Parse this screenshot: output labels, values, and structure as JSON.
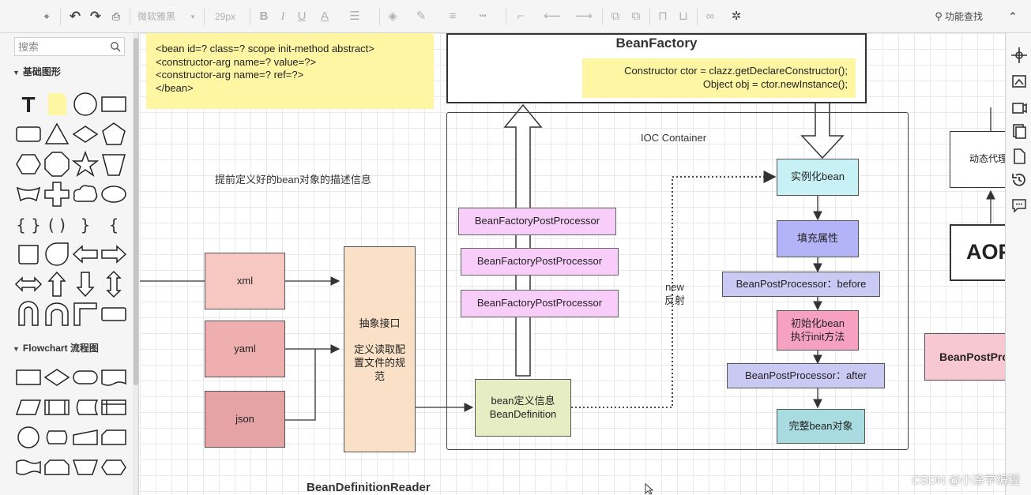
{
  "toolbar": {
    "font_family": "微软雅黑",
    "font_size": "29px",
    "search_label": "功能查找"
  },
  "sidebar": {
    "search_placeholder": "搜索",
    "section_basic": "基础图形",
    "section_flowchart": "Flowchart 流程图"
  },
  "diagram": {
    "note_bean_lines": [
      "<bean id=? class=? scope init-method  abstract>",
      "<constructor-arg name=? value=?>",
      "<constructor-arg  name=? ref=?>",
      "</bean>"
    ],
    "bean_factory_title": "BeanFactory",
    "ctor_note_lines": [
      "Constructor ctor = clazz.getDeclareConstructor();",
      "Object obj = ctor.newInstance();"
    ],
    "ioc_title": "IOC  Container",
    "desc_text": "提前定义好的bean对象的描述信息",
    "sources": [
      "xml",
      "yaml",
      "json"
    ],
    "reader_lines": [
      "抽象接口",
      "定义读取配置文件的规范"
    ],
    "reader_caption": "BeanDefinitionReader",
    "post_processors": [
      "BeanFactoryPostProcessor",
      "BeanFactoryPostProcessor",
      "BeanFactoryPostProcessor"
    ],
    "bean_def_lines": [
      "bean定义信息",
      "BeanDefinition"
    ],
    "new_label": "new",
    "reflect_label": "反射",
    "instantiate": "实例化bean",
    "populate": "填充属性",
    "bpp_before": "BeanPostProcessor：before",
    "init_lines": [
      "初始化bean",
      "执行init方法"
    ],
    "bpp_after": "BeanPostProcessor：after",
    "complete": "完整bean对象",
    "proxy": "动态代理",
    "aop": "AOP",
    "bpp_side": "BeanPostProcessor"
  },
  "watermark": "CSDN @小涂学编程",
  "colors": {
    "note_yellow": "#fff6a3",
    "pink": "#f7c8c2",
    "peach": "#fae0c6",
    "violet": "#f9cdf9",
    "olive": "#e7edc2",
    "cyan": "#c8f1f6",
    "lavender": "#b3b3f7",
    "light_lavender": "#c9c9f4",
    "rose": "#f7a1c0",
    "teal": "#a9dce0"
  }
}
